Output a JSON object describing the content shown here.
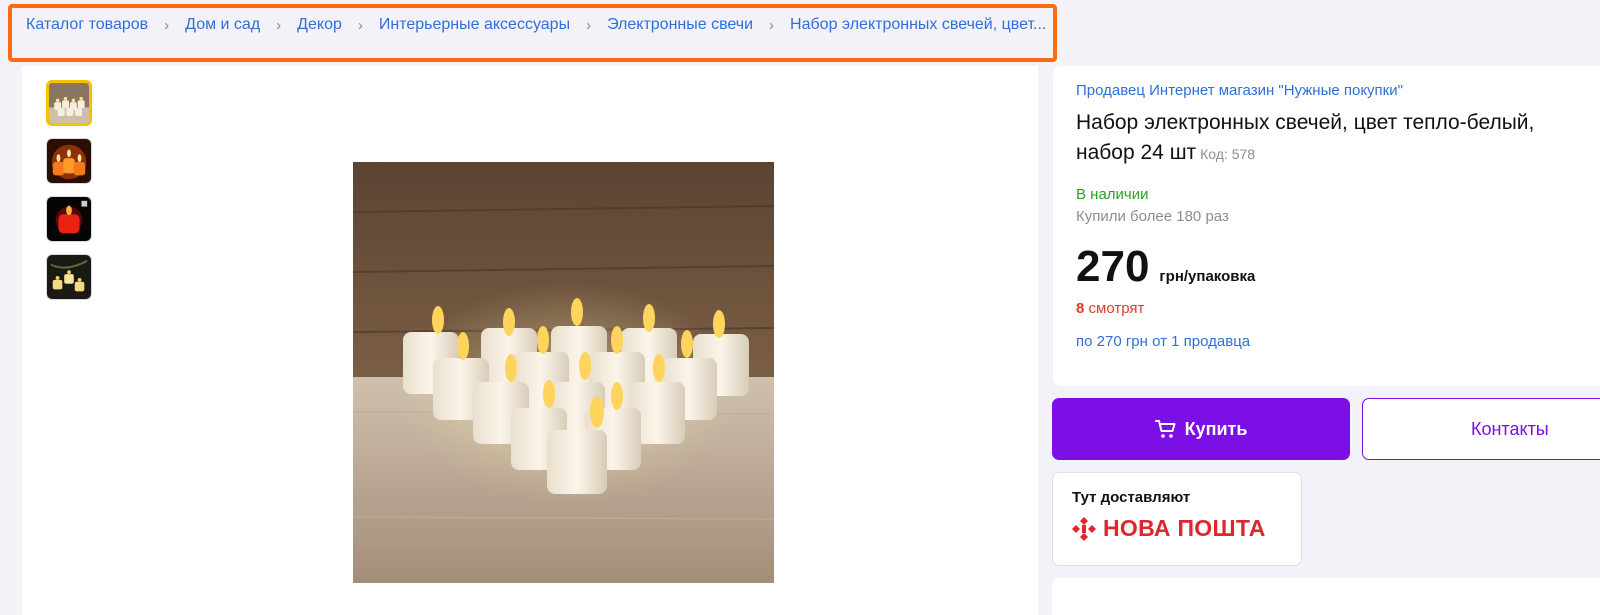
{
  "breadcrumbs": [
    "Каталог товаров",
    "Дом и сад",
    "Декор",
    "Интерьерные аксессуары",
    "Электронные свечи",
    "Набор электронных свечей, цвет..."
  ],
  "gallery": {
    "thumbnails": [
      "candles-thumb-1",
      "candles-thumb-2",
      "candles-thumb-3",
      "candles-thumb-4"
    ],
    "selected_index": 0
  },
  "product": {
    "seller": "Продавец Интернет магазин \"Нужные покупки\"",
    "title": "Набор электронных свечей, цвет тепло-белый, набор 24 шт",
    "code": "Код: 578",
    "stock": "В наличии",
    "bought": "Купили более 180 раз",
    "price": "270",
    "unit": "грн/упаковка",
    "watchers_count": "8",
    "watchers_label": "смотрят",
    "offers": "по 270 грн  от 1 продавца"
  },
  "actions": {
    "buy_label": "Купить",
    "contacts_label": "Контакты"
  },
  "delivery": {
    "label": "Тут доставляют",
    "carrier": "НОВА ПОШТА"
  },
  "colors": {
    "accent": "#7b0fe6",
    "link": "#2f6fd9",
    "stock": "#2aa12a",
    "watchers": "#e23b28",
    "highlight": "#ff6a13",
    "nova_poshta": "#e0262d"
  }
}
